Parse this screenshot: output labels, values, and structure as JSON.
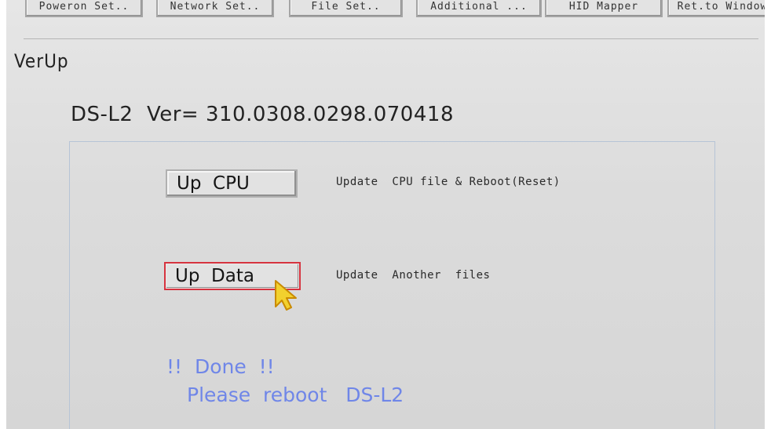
{
  "toolbar": {
    "buttons": [
      "Poweron Set..",
      "Network Set..",
      "File Set..",
      "Additional ...",
      "HID Mapper",
      "Ret.to Window"
    ]
  },
  "section": {
    "title": "VerUp"
  },
  "device": {
    "name": "DS-L2",
    "version_label": "Ver= 310.0308.0298.070418"
  },
  "actions": [
    {
      "label": "Up  CPU",
      "description": "Update  CPU file & Reboot(Reset)"
    },
    {
      "label": "Up  Data",
      "description": "Update  Another  files"
    }
  ],
  "status": {
    "line1": "!!  Done  !!",
    "line2": "Please  reboot   DS-L2"
  },
  "colors": {
    "focus_border": "#d6333f",
    "message": "#6f86e8",
    "cursor": "#f2d12e"
  },
  "icons": {
    "pointer": "mouse-pointer-icon"
  }
}
